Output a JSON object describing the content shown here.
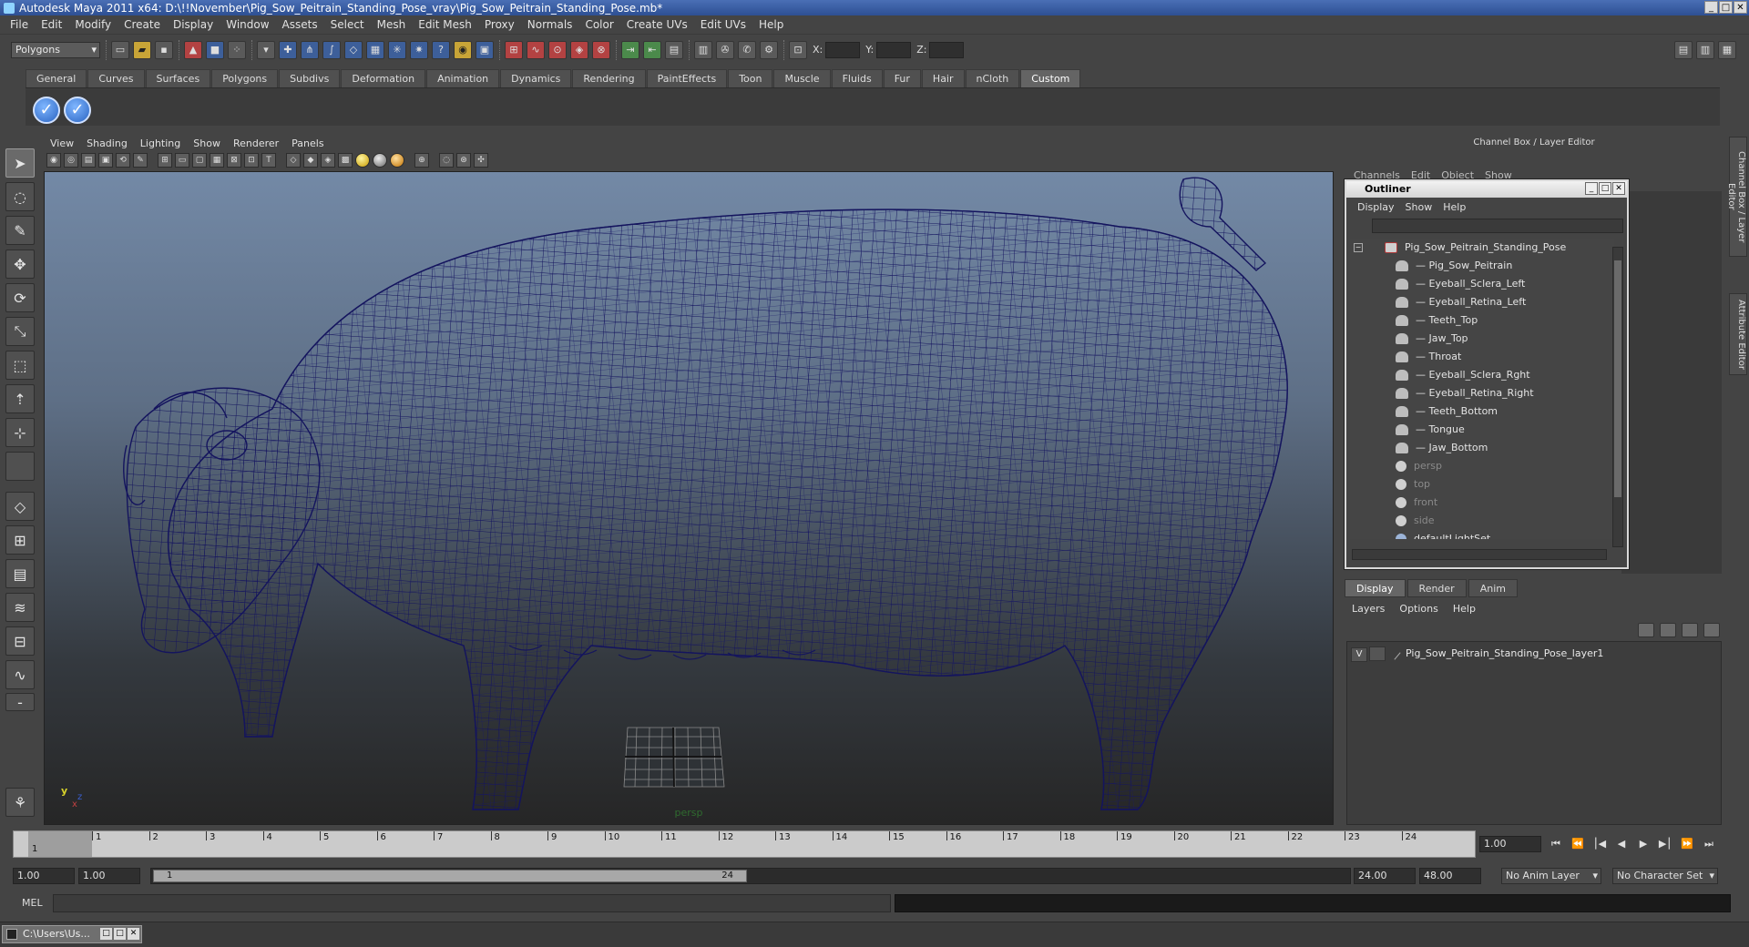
{
  "window": {
    "title": "Autodesk Maya 2011 x64: D:\\!!November\\Pig_Sow_Peitrain_Standing_Pose_vray\\Pig_Sow_Peitrain_Standing_Pose.mb*",
    "controls": [
      "_",
      "□",
      "✕"
    ]
  },
  "menubar": [
    "File",
    "Edit",
    "Modify",
    "Create",
    "Display",
    "Window",
    "Assets",
    "Select",
    "Mesh",
    "Edit Mesh",
    "Proxy",
    "Normals",
    "Color",
    "Create UVs",
    "Edit UVs",
    "Help"
  ],
  "statusline": {
    "mode": "Polygons",
    "x_label": "X:",
    "y_label": "Y:",
    "z_label": "Z:"
  },
  "shelf": {
    "tabs": [
      "General",
      "Curves",
      "Surfaces",
      "Polygons",
      "Subdivs",
      "Deformation",
      "Animation",
      "Dynamics",
      "Rendering",
      "PaintEffects",
      "Toon",
      "Muscle",
      "Fluids",
      "Fur",
      "Hair",
      "nCloth",
      "Custom"
    ],
    "active_tab": "Custom"
  },
  "panel": {
    "menu": [
      "View",
      "Shading",
      "Lighting",
      "Show",
      "Renderer",
      "Panels"
    ],
    "camera": "persp",
    "axis": {
      "y": "y",
      "x": "x",
      "z": "z"
    }
  },
  "channel_box": {
    "title": "Channel Box / Layer Editor",
    "menu": [
      "Channels",
      "Edit",
      "Object",
      "Show"
    ],
    "side_tabs": [
      "Channel Box / Layer Editor",
      "Attribute Editor"
    ]
  },
  "outliner": {
    "title": "Outliner",
    "menu": [
      "Display",
      "Show",
      "Help"
    ],
    "root": "Pig_Sow_Peitrain_Standing_Pose",
    "children": [
      "Pig_Sow_Peitrain",
      "Eyeball_Sclera_Left",
      "Eyeball_Retina_Left",
      "Teeth_Top",
      "Jaw_Top",
      "Throat",
      "Eyeball_Sclera_Rght",
      "Eyeball_Retina_Right",
      "Teeth_Bottom",
      "Tongue",
      "Jaw_Bottom"
    ],
    "cameras": [
      "persp",
      "top",
      "front",
      "side"
    ],
    "sets": [
      "defaultLightSet"
    ]
  },
  "layer_editor": {
    "tabs": [
      "Display",
      "Render",
      "Anim"
    ],
    "active_tab": "Display",
    "menu": [
      "Layers",
      "Options",
      "Help"
    ],
    "layers": [
      {
        "visible": "V",
        "name": "Pig_Sow_Peitrain_Standing_Pose_layer1"
      }
    ]
  },
  "timeslider": {
    "ticks": [
      "1",
      "2",
      "3",
      "4",
      "5",
      "6",
      "7",
      "8",
      "9",
      "10",
      "11",
      "12",
      "13",
      "14",
      "15",
      "16",
      "17",
      "18",
      "19",
      "20",
      "21",
      "22",
      "23",
      "24"
    ],
    "current_frame_marker": "1",
    "current_frame": "1.00"
  },
  "range": {
    "start_time": "1.00",
    "playback_start": "1.00",
    "range_start_label": "1",
    "range_end_label": "24",
    "playback_end": "24.00",
    "end_time": "48.00",
    "anim_layer": "No Anim Layer",
    "character_set": "No Character Set"
  },
  "commandline": {
    "label": "MEL"
  },
  "taskbar": {
    "item": "C:\\Users\\Us..."
  },
  "colors": {
    "wireframe": "#14145e",
    "viewport_top": "#7389a6",
    "viewport_bottom": "#262626",
    "title_bar": "#2d4f93"
  }
}
